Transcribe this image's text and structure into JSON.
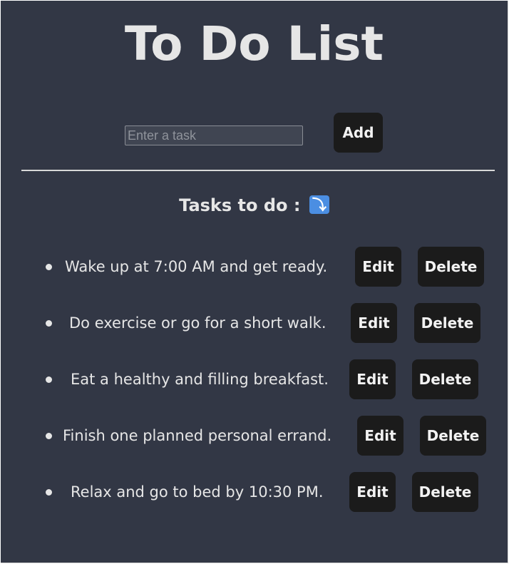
{
  "app": {
    "title": "To Do List"
  },
  "input": {
    "placeholder": "Enter a task",
    "value": ""
  },
  "add_button": {
    "label": "Add"
  },
  "tasks_section": {
    "heading": "Tasks to do :",
    "heading_emoji": "⤵"
  },
  "tasks": [
    {
      "text": "Wake up at 7:00 AM and get ready.",
      "edit_label": "Edit",
      "delete_label": "Delete"
    },
    {
      "text": "Do exercise or go for a short walk.",
      "edit_label": "Edit",
      "delete_label": "Delete"
    },
    {
      "text": "Eat a healthy and filling breakfast.",
      "edit_label": "Edit",
      "delete_label": "Delete"
    },
    {
      "text": "Finish one planned personal errand.",
      "edit_label": "Edit",
      "delete_label": "Delete"
    },
    {
      "text": "Relax and go to bed by 10:30 PM.",
      "edit_label": "Edit",
      "delete_label": "Delete"
    }
  ],
  "colors": {
    "background": "#323745",
    "button_bg": "#1b1b1b",
    "text": "#e6e6e6",
    "emoji_bg": "#4b8ee2"
  }
}
